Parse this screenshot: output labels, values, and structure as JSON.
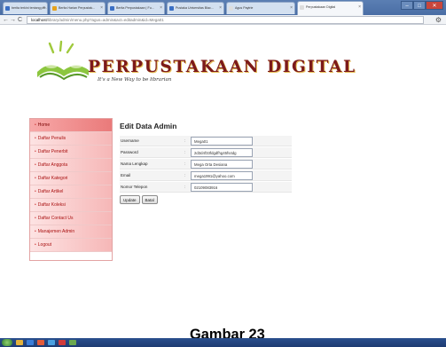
{
  "browser": {
    "tabs": [
      {
        "label": "berita terkini tentang per...",
        "favicon_color": "#3a6fc4"
      },
      {
        "label": "Berita Harian Perpustak...",
        "favicon_color": "#e6a21c"
      },
      {
        "label": "Berita Perpustakaan | Fu...",
        "favicon_color": "#3a6fc4"
      },
      {
        "label": "Pustaka Universitas Blac...",
        "favicon_color": "#3a6fc4"
      },
      {
        "label": "Agus Paytrie",
        "favicon_color": "#dddddd"
      },
      {
        "label": "Perpustakaan Digital",
        "favicon_color": "#dddddd"
      }
    ],
    "url_host": "localhost",
    "url_path": "/library/admin/menu.php?agus=admin&act=editadmin&id=Mega01"
  },
  "header": {
    "site_title": "PERPUSTAKAAN DIGITAL",
    "tagline": "It's a New Way to be librarian"
  },
  "sidebar": {
    "items": [
      {
        "label": "Home"
      },
      {
        "label": "Daftar Penulis"
      },
      {
        "label": "Daftar Penerbit"
      },
      {
        "label": "Daftar Anggota"
      },
      {
        "label": "Daftar Kategori"
      },
      {
        "label": "Daftar Artikel"
      },
      {
        "label": "Daftar Koleksi"
      },
      {
        "label": "Daftar Contact Us"
      },
      {
        "label": "Manajemen Admin"
      },
      {
        "label": "Logout"
      }
    ]
  },
  "content": {
    "title": "Edit Data Admin",
    "fields": [
      {
        "label": "Username",
        "value": "Mega01"
      },
      {
        "label": "Password",
        "value": "2d3d4f33fdgdfhg45fs4dg"
      },
      {
        "label": "Nama Lengkap",
        "value": "Mega Orta Desiana"
      },
      {
        "label": "Email",
        "value": "mega1991@yahoo.com"
      },
      {
        "label": "Nomor Telepon",
        "value": "02109083916"
      }
    ],
    "separator": ":",
    "update_label": "Update",
    "cancel_label": "Batal"
  },
  "caption": "Gambar 23",
  "taskbar": {
    "icon_colors": [
      "#e3b23c",
      "#3a7dd8",
      "#e25b3a",
      "#4aa0e0",
      "#d13a3a",
      "#6aa84f"
    ]
  }
}
